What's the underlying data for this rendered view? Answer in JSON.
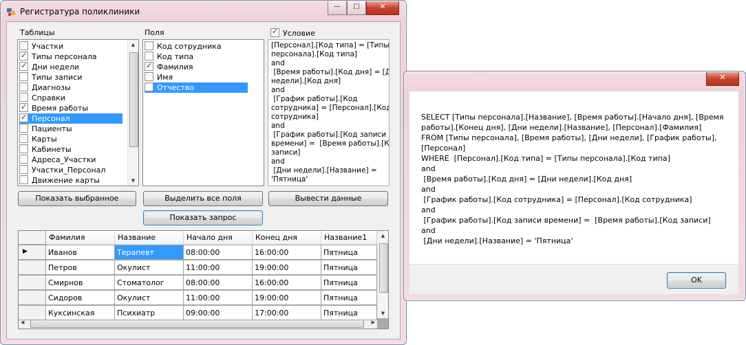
{
  "window": {
    "title": "Регистратура поликлиники",
    "min": "—",
    "max": "□",
    "close": "✕"
  },
  "tables_panel": {
    "label": "Таблицы",
    "items": [
      {
        "label": "Участки",
        "checked": false,
        "selected": false
      },
      {
        "label": "Типы персонала",
        "checked": true,
        "selected": false
      },
      {
        "label": "Дни недели",
        "checked": true,
        "selected": false
      },
      {
        "label": "Типы записи",
        "checked": false,
        "selected": false
      },
      {
        "label": "Диагнозы",
        "checked": false,
        "selected": false
      },
      {
        "label": "Справки",
        "checked": false,
        "selected": false
      },
      {
        "label": "Время работы",
        "checked": true,
        "selected": false
      },
      {
        "label": "Персонал",
        "checked": true,
        "selected": true
      },
      {
        "label": "Пациенты",
        "checked": false,
        "selected": false
      },
      {
        "label": "Карты",
        "checked": false,
        "selected": false
      },
      {
        "label": "Кабинеты",
        "checked": false,
        "selected": false
      },
      {
        "label": "Адреса_Участки",
        "checked": false,
        "selected": false
      },
      {
        "label": "Участки_Персонал",
        "checked": false,
        "selected": false
      },
      {
        "label": "Движение карты",
        "checked": false,
        "selected": false
      }
    ]
  },
  "fields_panel": {
    "label": "Поля",
    "items": [
      {
        "label": "Код сотрудника",
        "checked": false,
        "selected": false
      },
      {
        "label": "Код типа",
        "checked": false,
        "selected": false
      },
      {
        "label": "Фамилия",
        "checked": true,
        "selected": false
      },
      {
        "label": "Имя",
        "checked": false,
        "selected": false
      },
      {
        "label": "Отчество",
        "checked": false,
        "selected": true
      }
    ]
  },
  "condition_panel": {
    "label": "Условие",
    "checked": true,
    "lines": [
      "[Персонал].[Код типа] = [Типы",
      "персонала].[Код типа]",
      "and",
      " [Время работы].[Код дня] = [Дни",
      "недели].[Код дня]",
      "and",
      " [График работы].[Код",
      "сотрудника] = [Персонал].[Код",
      "сотрудника]",
      "and",
      " [График работы].[Код записи",
      "времени] =  [Время работы].[Код",
      "записи]",
      "and",
      " [Дни недели].[Название] =",
      "'Пятница'"
    ]
  },
  "buttons": {
    "show_selected": "Показать выбранное",
    "select_all_fields": "Выделить все поля",
    "output_data": "Вывести данные",
    "show_query": "Показать запрос"
  },
  "grid": {
    "columns": [
      "Фамилия",
      "Название",
      "Начало дня",
      "Конец дня",
      "Название1"
    ],
    "rows": [
      [
        "Иванов",
        "Терапевт",
        "08:00:00",
        "16:00:00",
        "Пятница"
      ],
      [
        "Петров",
        "Окулист",
        "11:00:00",
        "19:00:00",
        "Пятница"
      ],
      [
        "Смирнов",
        "Стоматолог",
        "08:00:00",
        "16:00:00",
        "Пятница"
      ],
      [
        "Сидоров",
        "Окулист",
        "11:00:00",
        "19:00:00",
        "Пятница"
      ],
      [
        "Куксинская",
        "Психиатр",
        "09:00:00",
        "17:00:00",
        "Пятница"
      ]
    ],
    "current_row_marker": "▶"
  },
  "dialog": {
    "close": "✕",
    "lines": [
      "SELECT [Типы персонала].[Название], [Время работы].[Начало дня], [Время",
      "работы].[Конец дня], [Дни недели].[Название], [Персонал].[Фамилия]",
      "FROM [Типы персонала], [Время работы], [Дни недели], [График работы],",
      "[Персонал]",
      "WHERE  [Персонал].[Код типа] = [Типы персонала].[Код типа]",
      "and",
      " [Время работы].[Код дня] = [Дни недели].[Код дня]",
      "and",
      " [График работы].[Код сотрудника] = [Персонал].[Код сотрудника]",
      "and",
      " [График работы].[Код записи времени] =  [Время работы].[Код записи]",
      "and",
      " [Дни недели].[Название] = 'Пятница'"
    ],
    "ok": "OK"
  }
}
